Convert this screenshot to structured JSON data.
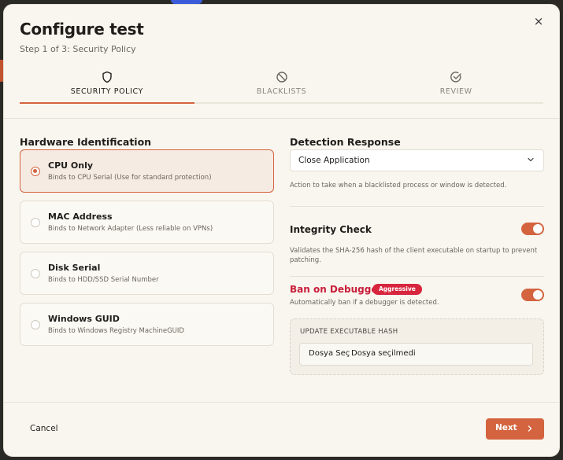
{
  "modal": {
    "title": "Configure test",
    "subtitle": "Step 1 of 3: Security Policy",
    "close_icon": "×"
  },
  "tabs": [
    {
      "label": "SECURITY POLICY",
      "icon": "shield-icon",
      "active": true
    },
    {
      "label": "BLACKLISTS",
      "icon": "ban-icon",
      "active": false
    },
    {
      "label": "REVIEW",
      "icon": "check-circle-icon",
      "active": false
    }
  ],
  "hardware": {
    "label": "Hardware Identification",
    "options": [
      {
        "title": "CPU Only",
        "desc": "Binds to CPU Serial (Use for standard protection)",
        "selected": true
      },
      {
        "title": "MAC Address",
        "desc": "Binds to Network Adapter (Less reliable on VPNs)",
        "selected": false
      },
      {
        "title": "Disk Serial",
        "desc": "Binds to HDD/SSD Serial Number",
        "selected": false
      },
      {
        "title": "Windows GUID",
        "desc": "Binds to Windows Registry MachineGUID",
        "selected": false
      }
    ]
  },
  "detection": {
    "label": "Detection Response",
    "selected": "Close Application",
    "help": "Action to take when a blacklisted process or window is detected."
  },
  "integrity": {
    "title": "Integrity Check",
    "help": "Validates the SHA-256 hash of the client executable on startup to prevent patching.",
    "enabled": true
  },
  "debugger": {
    "title": "Ban on Debugger",
    "badge": "Aggressive",
    "help": "Automatically ban if a debugger is detected.",
    "enabled": true
  },
  "upload": {
    "title": "UPDATE EXECUTABLE HASH",
    "button": "Dosya Seç",
    "status": "Dosya seçilmedi"
  },
  "footer": {
    "cancel": "Cancel",
    "next": "Next"
  },
  "colors": {
    "accent": "#d3643f",
    "danger": "#c81e3a",
    "badge": "#d7263d"
  }
}
